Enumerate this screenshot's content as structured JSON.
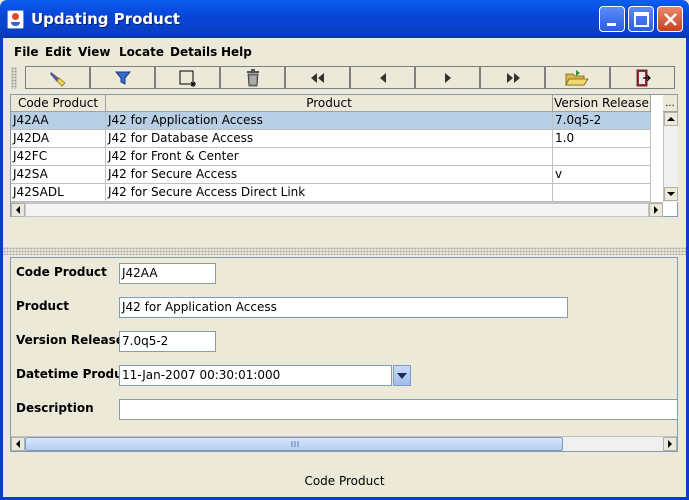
{
  "window": {
    "title": "Updating Product"
  },
  "menu": [
    "File",
    "Edit",
    "View",
    "Locate",
    "Details",
    "Help"
  ],
  "toolbar": {
    "buttons": [
      "flashlight-icon",
      "filter-icon",
      "new-record-icon",
      "trash-icon",
      "first-record-icon",
      "previous-record-icon",
      "next-record-icon",
      "last-record-icon",
      "open-folder-icon",
      "exit-door-icon"
    ]
  },
  "table": {
    "headers": [
      "Code Product",
      "Product",
      "Version Release"
    ],
    "corner_label": "...",
    "rows": [
      {
        "code": "J42AA",
        "product": "J42 for Application Access",
        "version": "7.0q5-2",
        "selected": true
      },
      {
        "code": "J42DA",
        "product": "J42 for Database Access",
        "version": "1.0",
        "selected": false
      },
      {
        "code": "J42FC",
        "product": "J42 for Front & Center",
        "version": "",
        "selected": false
      },
      {
        "code": "J42SA",
        "product": "J42 for Secure Access",
        "version": "v",
        "selected": false
      },
      {
        "code": "J42SADL",
        "product": "J42 for Secure Access Direct Link",
        "version": "",
        "selected": false
      }
    ]
  },
  "form": {
    "code_label": "Code Product",
    "code_value": "J42AA",
    "product_label": "Product",
    "product_value": "J42 for Application Access",
    "version_label": "Version Release",
    "version_value": "7.0q5-2",
    "datetime_label": "Datetime Product",
    "datetime_value": "11-Jan-2007 00:30:01:000",
    "description_label": "Description",
    "description_value": ""
  },
  "status": {
    "text": "Code Product"
  },
  "colors": {
    "titlebar": "#0a46d8",
    "selection": "#b8cfe5",
    "panel": "#ece9d8"
  }
}
